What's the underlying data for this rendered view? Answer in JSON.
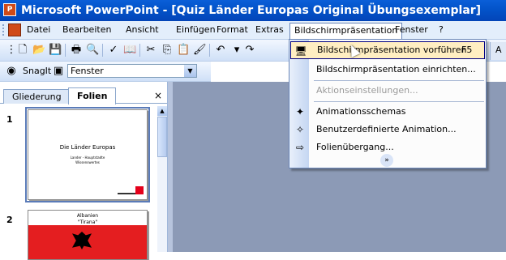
{
  "window": {
    "app_icon": "powerpoint-icon",
    "title": "Microsoft PowerPoint - [Quiz Länder Europas Original Übungsexemplar]"
  },
  "menubar": {
    "items": [
      {
        "label": "Datei"
      },
      {
        "label": "Bearbeiten"
      },
      {
        "label": "Ansicht"
      },
      {
        "label": "Einfügen"
      },
      {
        "label": "Format"
      },
      {
        "label": "Extras"
      },
      {
        "label": "Bildschirmpräsentation"
      },
      {
        "label": "Fenster"
      },
      {
        "label": "?"
      }
    ]
  },
  "toolbar": {
    "icons": [
      "new-icon",
      "open-icon",
      "save-icon",
      "print-icon",
      "print-preview-icon",
      "spelling-icon",
      "research-icon",
      "cut-icon",
      "copy-icon",
      "paste-icon",
      "format-painter-icon",
      "undo-icon",
      "redo-icon"
    ],
    "right_edge_text": "A"
  },
  "snagit_toolbar": {
    "label": "SnagIt",
    "combo_value": "Fenster"
  },
  "left_pane": {
    "tabs": [
      {
        "label": "Gliederung"
      },
      {
        "label": "Folien"
      }
    ],
    "close_glyph": "×",
    "slides": [
      {
        "number": "1",
        "title": "Die Länder Europas",
        "subtitle_line1": "Lander - Hauptstadte",
        "subtitle_line2": "Wissenswertes"
      },
      {
        "number": "2",
        "title_line1": "Albanien",
        "title_line2": "\"Tirana\""
      }
    ]
  },
  "dropdown": {
    "items": [
      {
        "label": "Bildschirmpräsentation vorführen",
        "shortcut": "F5",
        "icon": "slideshow-icon",
        "highlighted": true
      },
      {
        "label": "Bildschirmpräsentation einrichten..."
      },
      {
        "label": "Aktionseinstellungen...",
        "disabled": true
      },
      {
        "label": "Animationsschemas",
        "icon": "animation-schemes-icon"
      },
      {
        "label": "Benutzerdefinierte Animation...",
        "icon": "custom-animation-icon"
      },
      {
        "label": "Folienübergang...",
        "icon": "slide-transition-icon"
      }
    ],
    "expand_glyph": "»"
  }
}
